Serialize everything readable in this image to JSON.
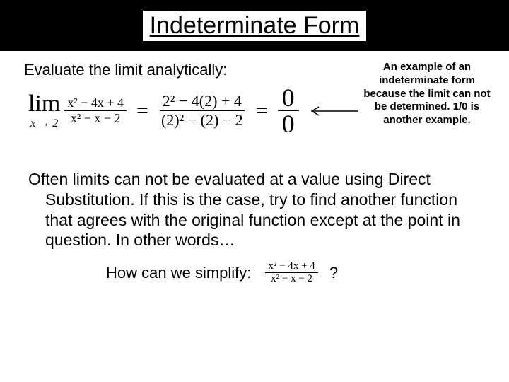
{
  "title": "Indeterminate Form",
  "subhead": "Evaluate the limit analytically:",
  "limit": {
    "word": "lim",
    "approach": "x → 2",
    "frac1": {
      "num": "x² − 4x + 4",
      "den": "x² − x − 2"
    },
    "eq": "=",
    "frac2": {
      "num": "2² − 4(2) + 4",
      "den": "(2)² − (2) − 2"
    },
    "frac3": {
      "num": "0",
      "den": "0"
    }
  },
  "note": "An example of an indeterminate form because the limit can not be determined. 1/0 is another example.",
  "body": "Often limits can not be evaluated at a value using Direct Substitution.  If this is the case, try to find another function that agrees with the original function except at the point in question.  In other words…",
  "simplify": {
    "prompt": "How can we simplify:",
    "frac": {
      "num": "x² − 4x + 4",
      "den": "x² − x − 2"
    },
    "q": "?"
  }
}
